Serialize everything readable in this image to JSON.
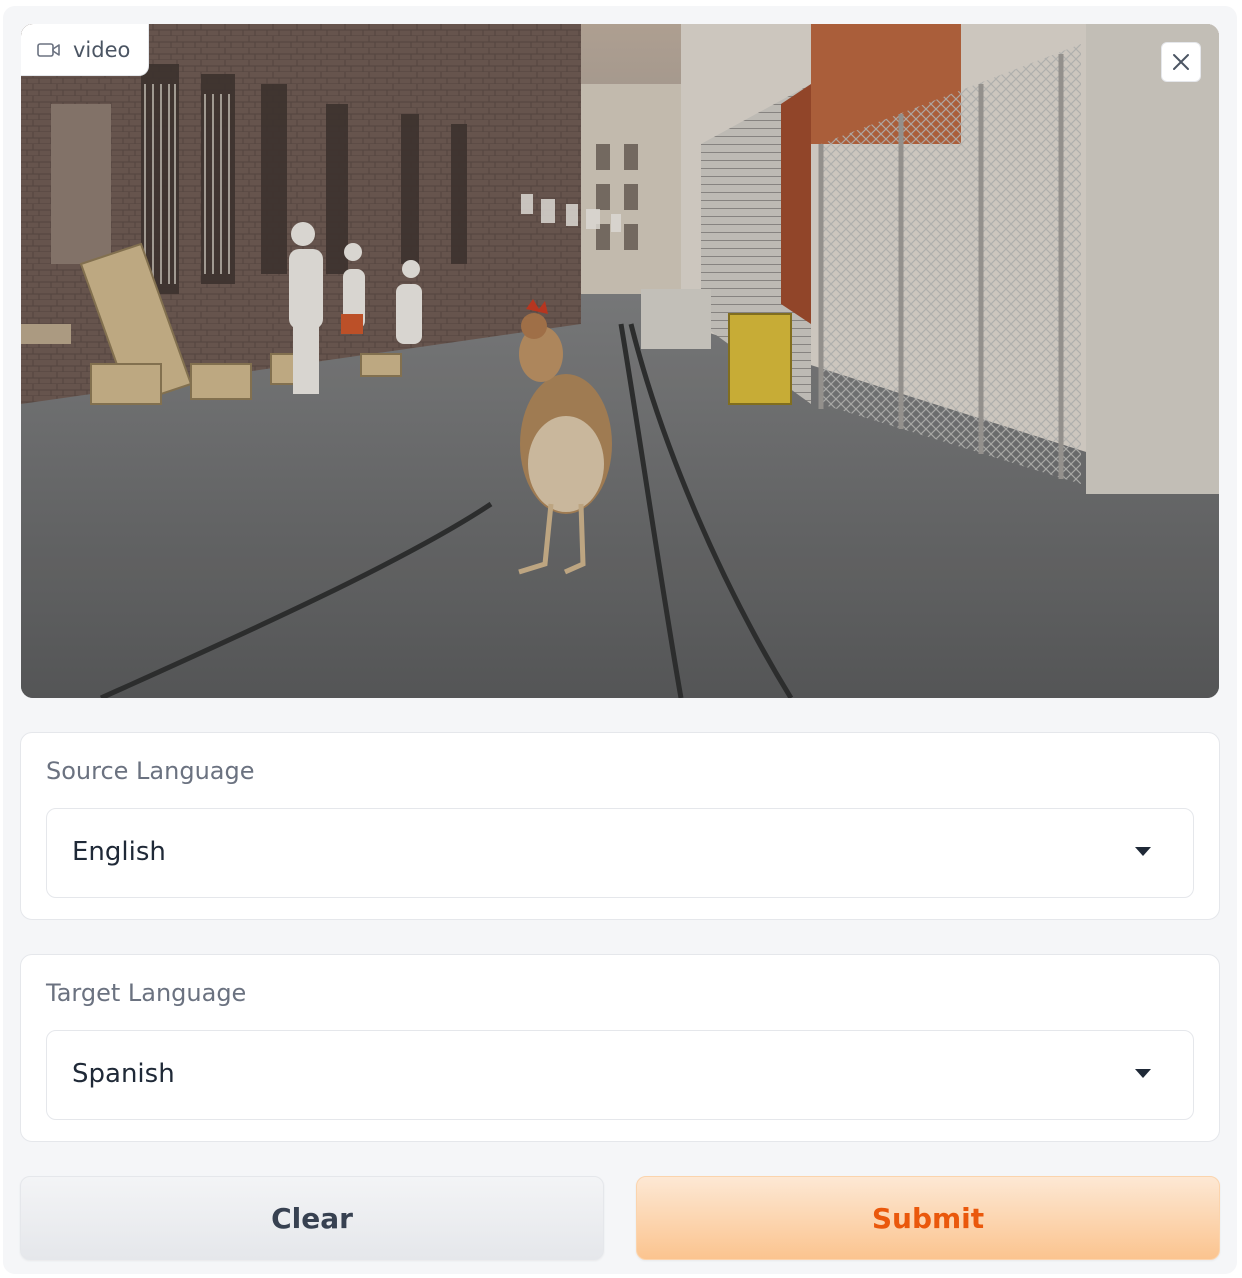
{
  "video": {
    "label": "video",
    "label_icon": "video-camera-icon",
    "close_icon": "close-icon",
    "scene": "a chicken walking down an alley"
  },
  "source_language": {
    "label": "Source Language",
    "value": "English"
  },
  "target_language": {
    "label": "Target Language",
    "value": "Spanish"
  },
  "buttons": {
    "clear": "Clear",
    "submit": "Submit"
  },
  "colors": {
    "submit_text": "#ea580c",
    "submit_bg_top": "#fde8d4",
    "submit_bg_bottom": "#fbc48f",
    "clear_text": "#374151"
  }
}
